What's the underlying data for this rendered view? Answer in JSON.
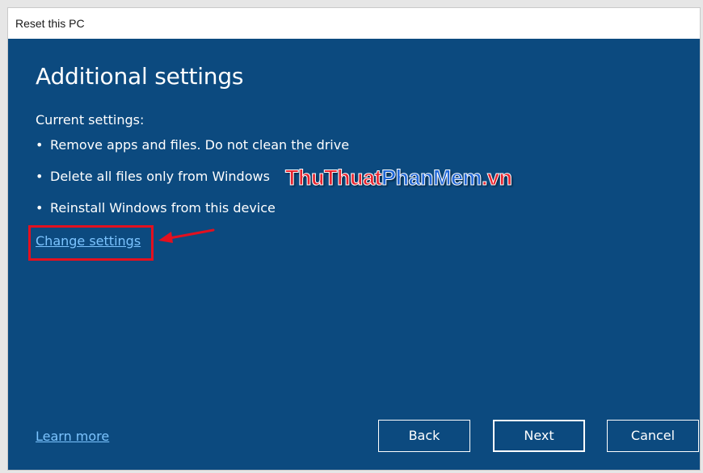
{
  "window": {
    "title": "Reset this PC"
  },
  "main": {
    "heading": "Additional settings",
    "current_settings_label": "Current settings:",
    "bullet_char": "•",
    "settings": [
      "Remove apps and files. Do not clean the drive",
      "Delete all files only from Windows",
      "Reinstall Windows from this device"
    ],
    "change_settings_link": "Change settings"
  },
  "watermark": {
    "part1": "ThuThuat",
    "part2": "PhanMem",
    "part3": ".vn"
  },
  "footer": {
    "learn_more_link": "Learn more",
    "back_label": "Back",
    "next_label": "Next",
    "cancel_label": "Cancel"
  },
  "colors": {
    "background": "#0c4a7f",
    "link": "#7cc4ff",
    "highlight_box": "#e3101f"
  },
  "icons": {
    "annotation_arrow": "red-arrow-icon"
  }
}
